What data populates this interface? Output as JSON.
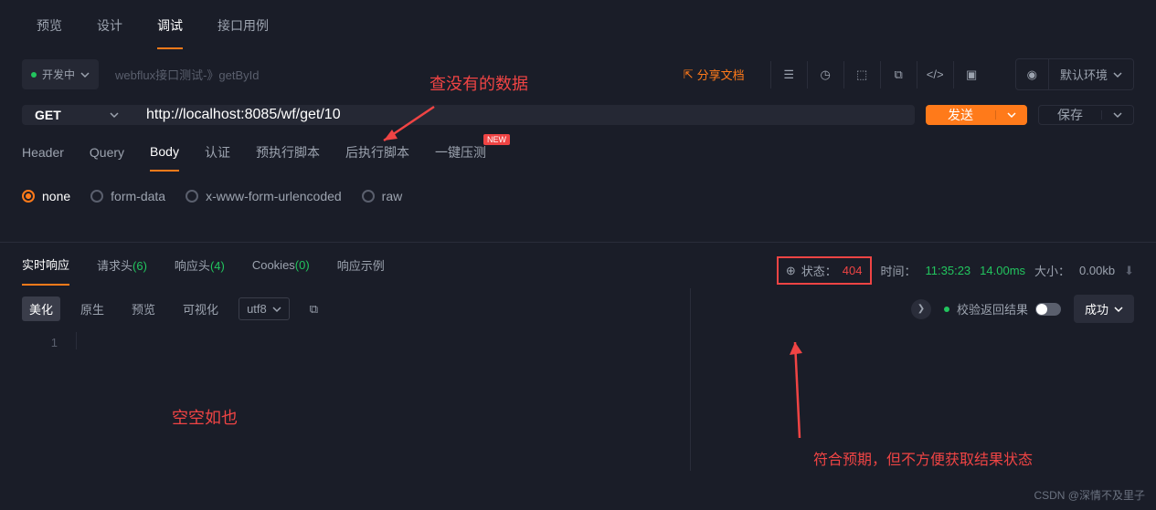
{
  "mainTabs": [
    "预览",
    "设计",
    "调试",
    "接口用例"
  ],
  "mainTabActive": 2,
  "status": {
    "label": "开发中"
  },
  "placeholder": "webflux接口测试-》getById",
  "shareLabel": "分享文档",
  "env": {
    "label": "默认环境"
  },
  "request": {
    "method": "GET",
    "url": "http://localhost:8085/wf/get/10"
  },
  "btnSend": "发送",
  "btnSave": "保存",
  "subTabs": [
    "Header",
    "Query",
    "Body",
    "认证",
    "预执行脚本",
    "后执行脚本",
    "一键压测"
  ],
  "subTabActive": 2,
  "badgeNew": "NEW",
  "bodyTypes": [
    "none",
    "form-data",
    "x-www-form-urlencoded",
    "raw"
  ],
  "bodyTypeActive": 0,
  "respTabs": {
    "t0": "实时响应",
    "t1": "请求头",
    "t1c": "(6)",
    "t2": "响应头",
    "t2c": "(4)",
    "t3": "Cookies",
    "t3c": "(0)",
    "t4": "响应示例"
  },
  "respTabActive": 0,
  "respMeta": {
    "statusLabel": "状态：",
    "statusVal": "404",
    "timeLabel": "时间：",
    "timeVal": "11:35:23",
    "duration": "14.00ms",
    "sizeLabel": "大小：",
    "sizeVal": "0.00kb"
  },
  "viewModes": {
    "v0": "美化",
    "v1": "原生",
    "v2": "预览",
    "v3": "可视化"
  },
  "encoding": "utf8",
  "checkLabel": "校验返回结果",
  "successLabel": "成功",
  "lineNum": "1",
  "annotations": {
    "a1": "查没有的数据",
    "a2": "空空如也",
    "a3": "符合预期，但不方便获取结果状态"
  },
  "watermark": "CSDN @深情不及里子"
}
